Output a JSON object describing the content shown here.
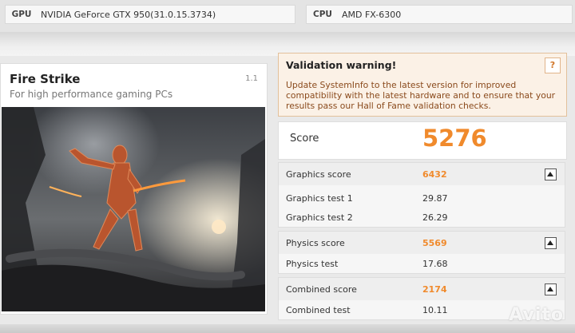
{
  "system": {
    "gpu_label": "GPU",
    "gpu_value": "NVIDIA GeForce GTX 950(31.0.15.3734)",
    "cpu_label": "CPU",
    "cpu_value": "AMD FX-6300"
  },
  "test": {
    "title": "Fire Strike",
    "subtitle": "For high performance gaming PCs",
    "version": "1.1"
  },
  "validation": {
    "title": "Validation warning!",
    "help": "?",
    "message": "Update SystemInfo to the latest version for improved compatibility with the latest hardware and to ensure that your results pass our Hall of Fame validation checks."
  },
  "score": {
    "label": "Score",
    "value": "5276"
  },
  "results": {
    "graphics": {
      "label": "Graphics score",
      "value": "6432",
      "tests": [
        {
          "label": "Graphics test 1",
          "value": "29.87"
        },
        {
          "label": "Graphics test 2",
          "value": "26.29"
        }
      ]
    },
    "physics": {
      "label": "Physics score",
      "value": "5569",
      "tests": [
        {
          "label": "Physics test",
          "value": "17.68"
        }
      ]
    },
    "combined": {
      "label": "Combined score",
      "value": "2174",
      "tests": [
        {
          "label": "Combined test",
          "value": "10.11"
        }
      ]
    }
  },
  "colors": {
    "accent": "#f08a2c",
    "warning_bg": "#fbf1e6",
    "warning_text": "#8a4a1c"
  },
  "icons": {
    "collapse": "collapse-arrow-icon",
    "help": "question-icon"
  },
  "watermark": "Avito"
}
